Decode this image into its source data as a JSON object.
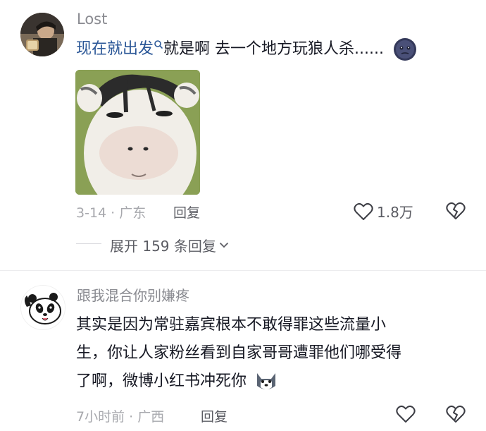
{
  "comments": [
    {
      "username": "Lost",
      "link_text": "现在就出发",
      "text": "就是啊 去一个地方玩狼人杀......",
      "meta": "3-14 · 广东",
      "reply_label": "回复",
      "likes": "1.8万"
    },
    {
      "username": "跟我混合你别嫌疼",
      "text_line1": "其实是因为常驻嘉宾根本不敢得罪这些流量小",
      "text_line2": "生，你让人家粉丝看到自家哥哥遭罪他们哪受得",
      "text_line3": "了啊，微博小红书冲死你",
      "meta": "7小时前 · 广西",
      "reply_label": "回复"
    }
  ],
  "expand": {
    "label": "展开 159 条回复"
  },
  "icons": {
    "search": "search-icon",
    "like": "heart-outline-icon",
    "dislike": "broken-heart-icon",
    "chevron": "chevron-down-icon"
  },
  "colors": {
    "link": "#2b5797",
    "meta": "#a7a8ad",
    "text": "#161823"
  }
}
